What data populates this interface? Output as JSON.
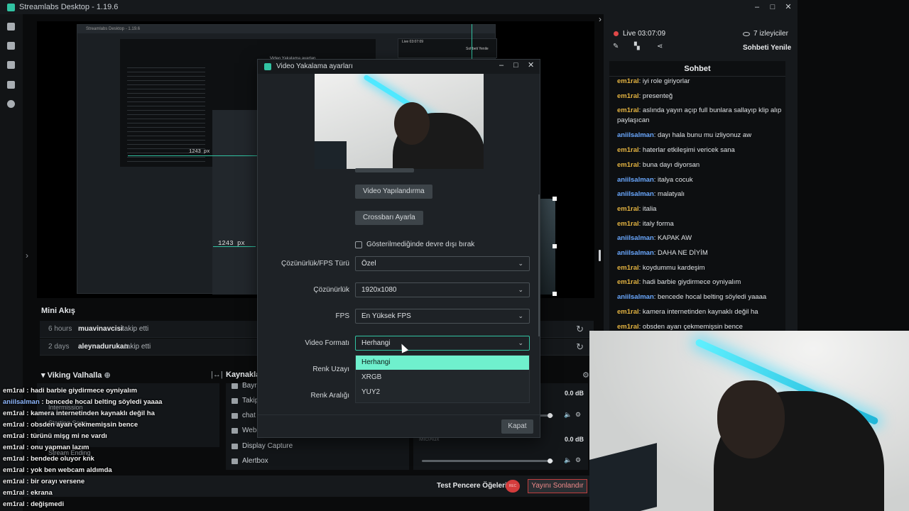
{
  "app": {
    "title": "Streamlabs Desktop - 1.19.6"
  },
  "editor": {
    "px_label_top": "1243 px",
    "px_label_bottom": "1243 px",
    "nested_title": "Streamlabs Desktop - 1.19.6",
    "nested_live": "Live 03:07:09",
    "nested_refresh": "Sohbeti Yenile",
    "nested_video_title": "Video Yakalama ayarları"
  },
  "mini_feed": {
    "title": "Mini Akış",
    "items": [
      {
        "time": "6 hours",
        "user": "muavinavcisi",
        "action": "takip etti"
      },
      {
        "time": "2 days",
        "user": "aleynadurukan",
        "action": "takip etti"
      }
    ]
  },
  "scenes": {
    "title": "Viking Valhalla",
    "ghost_items": [
      "Intermission",
      "Starting Soon",
      "Stream Ending"
    ]
  },
  "sources": {
    "title": "Kaynakla",
    "items": [
      "Bayra",
      "Takip",
      "chat",
      "Webc",
      "Display Capture",
      "Alertbox"
    ]
  },
  "mixer": {
    "tracks": [
      {
        "db": "0.0 dB",
        "level": 0.95
      },
      {
        "label": "Mic/Aux",
        "db": "0.0 dB",
        "level": 0.95
      }
    ]
  },
  "footer": {
    "test_label": "Test Pencere Öğeleri",
    "rec_label": "REC",
    "end_stream": "Yayını Sonlandır"
  },
  "overlay_chat": [
    {
      "user": "em1ral",
      "text": "hadi barbie giydirmece oyniyalım"
    },
    {
      "user": "aniilsalman",
      "text": "bencede hocal belting söyledi yaaaa",
      "alt": true
    },
    {
      "user": "em1ral",
      "text": "kamera internetinden kaynaklı değil ha"
    },
    {
      "user": "em1ral",
      "text": "obsden ayarı çekmemişsin bence"
    },
    {
      "user": "em1ral",
      "text": "türünü mişg mi ne vardı"
    },
    {
      "user": "em1ral",
      "text": "onu yapman lazım"
    },
    {
      "user": "em1ral",
      "text": "bendede oluyor knk"
    },
    {
      "user": "em1ral",
      "text": "yok ben webcam aldımda"
    },
    {
      "user": "em1ral",
      "text": "bir orayı versene"
    },
    {
      "user": "em1ral",
      "text": "ekrana"
    },
    {
      "user": "em1ral",
      "text": "değişmedi"
    }
  ],
  "chat_panel": {
    "live": "Live 03:07:09",
    "viewers": "7 izleyiciler",
    "refresh": "Sohbeti Yenile",
    "header": "Sohbet",
    "messages": [
      {
        "user": "em1ral",
        "text": "iyi role giriyorlar"
      },
      {
        "user": "em1ral",
        "text": "presenteğ"
      },
      {
        "user": "em1ral",
        "text": "aslında yayın açıp full bunlara sallayıp klip alıp paylaşıcan"
      },
      {
        "user": "aniilsalman",
        "text": "dayı hala bunu mu izliyonuz aw",
        "blue": true
      },
      {
        "user": "em1ral",
        "text": "haterlar etkileşimi vericek sana"
      },
      {
        "user": "em1ral",
        "text": "buna dayı diyorsan"
      },
      {
        "user": "aniilsalman",
        "text": "italya cocuk",
        "blue": true
      },
      {
        "user": "aniilsalman",
        "text": "malatyalı",
        "blue": true
      },
      {
        "user": "em1ral",
        "text": "italia"
      },
      {
        "user": "em1ral",
        "text": "italy forma"
      },
      {
        "user": "aniilsalman",
        "text": "KAPAK AW",
        "blue": true
      },
      {
        "user": "aniilsalman",
        "text": "DAHA NE DİYİM",
        "blue": true
      },
      {
        "user": "em1ral",
        "text": "koydummu kardeşim"
      },
      {
        "user": "em1ral",
        "text": "hadi barbie giydirmece oyniyalım"
      },
      {
        "user": "aniilsalman",
        "text": "bencede hocal belting söyledi yaaaa",
        "blue": true
      },
      {
        "user": "em1ral",
        "text": "kamera internetinden kaynaklı değil ha"
      },
      {
        "user": "em1ral",
        "text": "obsden ayarı çekmemişsin bence"
      }
    ]
  },
  "dialog": {
    "title": "Video Yakalama ayarları",
    "btn_video_config": "Video Yapılandırma",
    "btn_crossbar": "Crossbarı Ayarla",
    "checkbox_label": "Gösterilmediğinde devre dışı bırak",
    "fields": [
      {
        "label": "Çözünürlük/FPS Türü",
        "value": "Özel"
      },
      {
        "label": "Çözünürlük",
        "value": "1920x1080"
      },
      {
        "label": "FPS",
        "value": "En Yüksek FPS"
      },
      {
        "label": "Video Formatı",
        "value": "Herhangi"
      },
      {
        "label": "Renk Uzayı",
        "value": ""
      },
      {
        "label": "Renk Aralığı",
        "value": ""
      }
    ],
    "dropdown_options": [
      "Herhangi",
      "XRGB",
      "YUY2"
    ],
    "close": "Kapat"
  }
}
